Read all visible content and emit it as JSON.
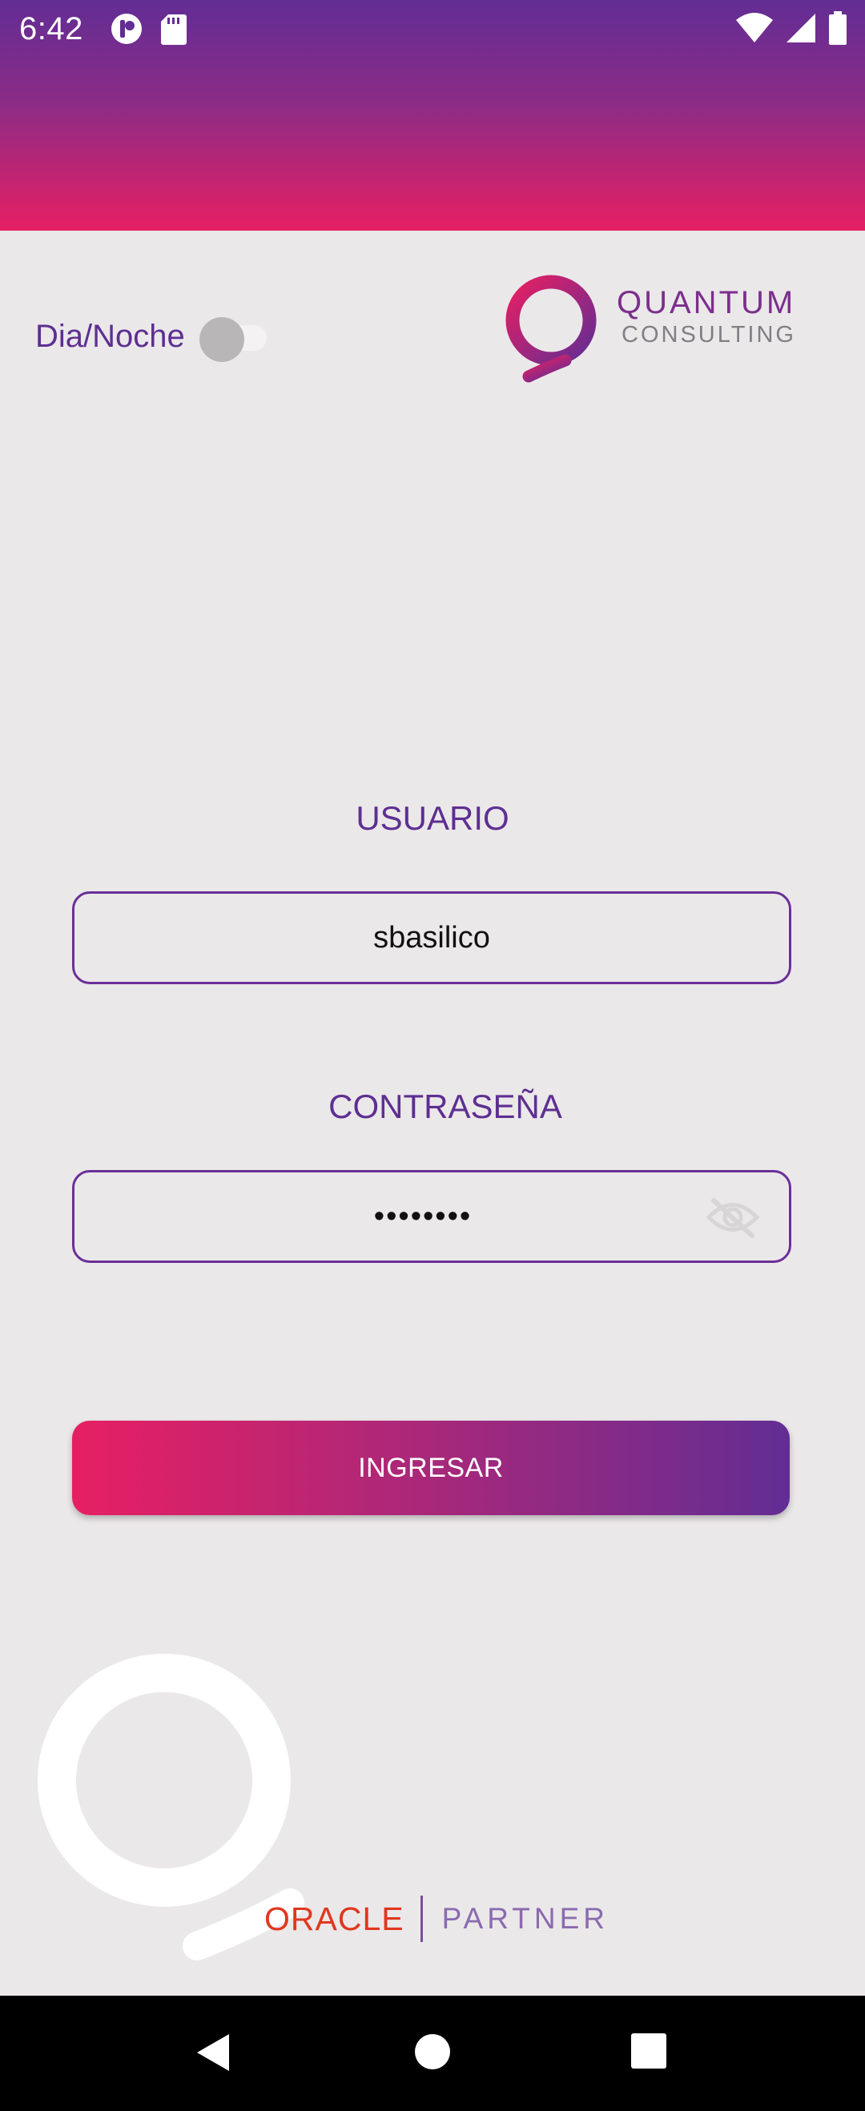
{
  "status_bar": {
    "time": "6:42",
    "left_icons": [
      "notification-app-icon",
      "sd-card-icon"
    ],
    "right_icons": [
      "wifi-icon",
      "signal-icon",
      "battery-icon"
    ]
  },
  "theme_toggle": {
    "label": "Dia/Noche",
    "checked": false
  },
  "brand": {
    "name": "QUANTUM",
    "subtitle": "CONSULTING"
  },
  "login_form": {
    "username_label": "USUARIO",
    "username_value": "sbasilico",
    "password_label": "CONTRASEÑA",
    "password_masked": "••••••••",
    "submit_label": "INGRESAR"
  },
  "footer": {
    "partner_brand": "ORACLE",
    "partner_label": "PARTNER"
  },
  "colors": {
    "primary_purple": "#5e2f92",
    "accent_pink": "#e71f63",
    "oracle_red": "#e0371d"
  }
}
